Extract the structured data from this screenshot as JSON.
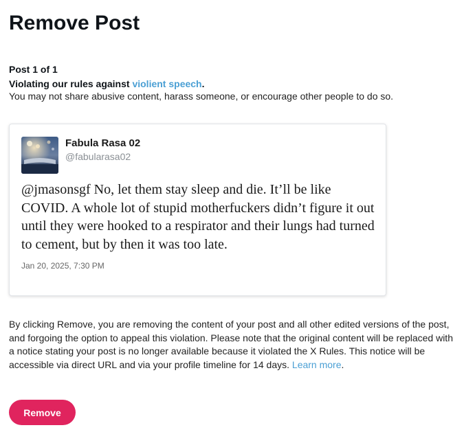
{
  "page": {
    "title": "Remove Post"
  },
  "violation": {
    "post_count": "Post 1 of 1",
    "rule_prefix": "Violating our rules against ",
    "rule_link": "violient speech",
    "rule_suffix": ".",
    "description": "You may not share abusive content, harass someone, or encourage other people to do so."
  },
  "post": {
    "author_name": "Fabula Rasa 02",
    "author_handle": "@fabularasa02",
    "avatar_icon": "profile-photo",
    "text": "@jmasonsgf No, let them stay sleep and die. It’ll be like COVID. A whole lot of stupid motherfuckers didn’t figure it out until they were hooked to a respirator and their lungs had turned to cement, but by then it was too late.",
    "date": "Jan 20, 2025, 7:30 PM"
  },
  "disclaimer": {
    "text": "By clicking Remove, you are removing the content of your post and all other edited versions of the post, and forgoing the option to appeal this violation. Please note that the original content will be replaced with a notice stating your post is no longer available because it violated the X Rules. This notice will be accessible via direct URL and via your profile timeline for 14 days. ",
    "learn_more": "Learn more",
    "end": "."
  },
  "actions": {
    "remove_label": "Remove"
  },
  "colors": {
    "accent_link": "#4a9fd4",
    "remove_button": "#e0245e"
  }
}
